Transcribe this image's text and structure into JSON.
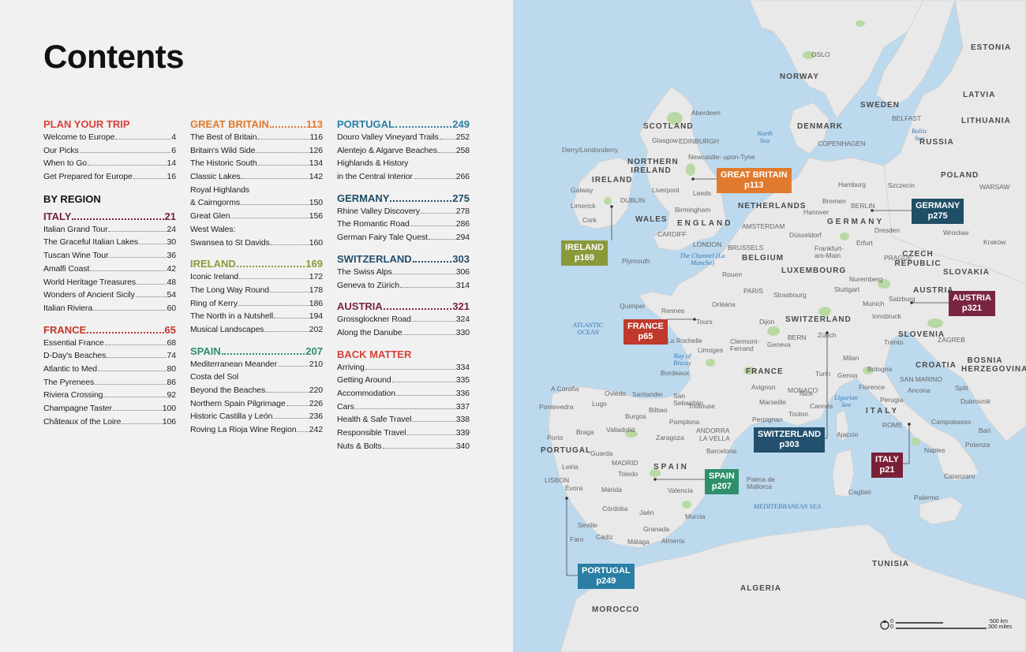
{
  "page_title": "Contents",
  "colors": {
    "plan": "#d9413a",
    "italy": "#7a2036",
    "france": "#c0392b",
    "great_britain": "#e07a2e",
    "ireland": "#8a9a3a",
    "spain": "#2f8f6b",
    "portugal": "#2a7ea4",
    "germany": "#1f4e66",
    "switzerland": "#23506e",
    "austria": "#7a2540",
    "back": "#d9413a"
  },
  "col1": {
    "plan": {
      "title": "PLAN YOUR TRIP",
      "entries": [
        {
          "name": "Welcome to Europe",
          "page": "4"
        },
        {
          "name": "Our Picks",
          "page": "6"
        },
        {
          "name": "When to Go",
          "page": "14"
        },
        {
          "name": "Get Prepared for Europe",
          "page": "16"
        }
      ]
    },
    "by_region": "BY REGION",
    "italy": {
      "title": "ITALY",
      "page": "21",
      "entries": [
        {
          "name": "Italian Grand Tour",
          "page": "24"
        },
        {
          "name": "The Graceful Italian Lakes",
          "page": "30"
        },
        {
          "name": "Tuscan Wine Tour",
          "page": "36"
        },
        {
          "name": "Amalfi Coast",
          "page": "42"
        },
        {
          "name": "World Heritage Treasures",
          "page": "48"
        },
        {
          "name": "Wonders of Ancient Sicily",
          "page": "54"
        },
        {
          "name": "Italian Riviera",
          "page": "60"
        }
      ]
    },
    "france": {
      "title": "FRANCE",
      "page": "65",
      "entries": [
        {
          "name": "Essential France",
          "page": "68"
        },
        {
          "name": "D-Day's Beaches",
          "page": "74"
        },
        {
          "name": "Atlantic to Med",
          "page": "80"
        },
        {
          "name": "The Pyrenees",
          "page": "86"
        },
        {
          "name": "Riviera Crossing",
          "page": "92"
        },
        {
          "name": "Champagne Taster",
          "page": "100"
        },
        {
          "name": "Châteaux of the Loire",
          "page": "106"
        }
      ]
    }
  },
  "col2": {
    "great_britain": {
      "title": "GREAT BRITAIN",
      "page": "113",
      "entries": [
        {
          "name": "The Best of Britain",
          "page": "116"
        },
        {
          "name": "Britain's Wild Side",
          "page": "126"
        },
        {
          "name": "The Historic South",
          "page": "134"
        },
        {
          "name": "Classic Lakes",
          "page": "142"
        },
        {
          "name": "Royal Highlands",
          "page": ""
        },
        {
          "name": "& Cairngorms",
          "page": "150"
        },
        {
          "name": "Great Glen",
          "page": "156"
        },
        {
          "name": "West Wales:",
          "page": ""
        },
        {
          "name": "Swansea to St Davids",
          "page": "160"
        }
      ]
    },
    "ireland": {
      "title": "IRELAND",
      "page": "169",
      "entries": [
        {
          "name": "Iconic Ireland",
          "page": "172"
        },
        {
          "name": "The Long Way Round",
          "page": "178"
        },
        {
          "name": "Ring of Kerry",
          "page": "186"
        },
        {
          "name": "The North in a Nutshell",
          "page": "194"
        },
        {
          "name": "Musical Landscapes",
          "page": "202"
        }
      ]
    },
    "spain": {
      "title": "SPAIN",
      "page": "207",
      "entries": [
        {
          "name": "Mediterranean Meander",
          "page": "210"
        },
        {
          "name": "Costa del Sol",
          "page": ""
        },
        {
          "name": "Beyond the Beaches",
          "page": "220"
        },
        {
          "name": "Northern Spain Pilgrimage",
          "page": "226"
        },
        {
          "name": "Historic Castilla y León",
          "page": "236"
        },
        {
          "name": "Roving La Rioja Wine Region",
          "page": "242"
        }
      ]
    }
  },
  "col3": {
    "portugal": {
      "title": "PORTUGAL",
      "page": "249",
      "entries": [
        {
          "name": "Douro Valley Vineyard Trails",
          "page": "252"
        },
        {
          "name": "Alentejo & Algarve Beaches",
          "page": "258"
        },
        {
          "name": "Highlands & History",
          "page": ""
        },
        {
          "name": "in the Central Interior",
          "page": "266"
        }
      ]
    },
    "germany": {
      "title": "GERMANY",
      "page": "275",
      "entries": [
        {
          "name": "Rhine Valley Discovery",
          "page": "278"
        },
        {
          "name": "The Romantic Road",
          "page": "286"
        },
        {
          "name": "German Fairy Tale Quest",
          "page": "294"
        }
      ]
    },
    "switzerland": {
      "title": "SWITZERLAND",
      "page": "303",
      "entries": [
        {
          "name": "The Swiss Alps",
          "page": "306"
        },
        {
          "name": "Geneva to Zürich",
          "page": "314"
        }
      ]
    },
    "austria": {
      "title": "AUSTRIA",
      "page": "321",
      "entries": [
        {
          "name": "Grossglockner Road",
          "page": "324"
        },
        {
          "name": "Along the Danube",
          "page": "330"
        }
      ]
    },
    "back": {
      "title": "BACK MATTER",
      "entries": [
        {
          "name": "Arriving",
          "page": "334"
        },
        {
          "name": "Getting Around",
          "page": "335"
        },
        {
          "name": "Accommodation",
          "page": "336"
        },
        {
          "name": "Cars",
          "page": "337"
        },
        {
          "name": "Health & Safe Travel",
          "page": "338"
        },
        {
          "name": "Responsible Travel",
          "page": "339"
        },
        {
          "name": "Nuts & Bolts",
          "page": "340"
        }
      ]
    }
  },
  "map": {
    "callouts": {
      "great_britain": {
        "name": "GREAT BRITAIN",
        "page": "p113"
      },
      "ireland": {
        "name": "IRELAND",
        "page": "p169"
      },
      "germany": {
        "name": "GERMANY",
        "page": "p275"
      },
      "france": {
        "name": "FRANCE",
        "page": "p65"
      },
      "austria": {
        "name": "AUSTRIA",
        "page": "p321"
      },
      "switzerland": {
        "name": "SWITZERLAND",
        "page": "p303"
      },
      "italy": {
        "name": "ITALY",
        "page": "p21"
      },
      "spain": {
        "name": "SPAIN",
        "page": "p207"
      },
      "portugal": {
        "name": "PORTUGAL",
        "page": "p249"
      }
    },
    "countries": {
      "norway": "NORWAY",
      "sweden": "SWEDEN",
      "estonia": "ESTONIA",
      "latvia": "LATVIA",
      "lithuania": "LITHUANIA",
      "russia": "RUSSIA",
      "denmark": "DENMARK",
      "scotland": "SCOTLAND",
      "northern_ireland": "NORTHERN IRELAND",
      "ireland": "IRELAND",
      "wales": "WALES",
      "england": "ENGLAND",
      "netherlands": "NETHERLANDS",
      "germany": "GERMANY",
      "poland": "POLAND",
      "belgium": "BELGIUM",
      "luxembourg": "LUXEMBOURG",
      "czech": "CZECH REPUBLIC",
      "slovakia": "SLOVAKIA",
      "austria": "AUSTRIA",
      "switzerland": "SWITZERLAND",
      "slovenia": "SLOVENIA",
      "croatia": "CROATIA",
      "bosnia": "BOSNIA HERZEGOVINA",
      "france": "FRANCE",
      "monaco": "MONACO",
      "san_marino": "SAN MARINO",
      "italy": "ITALY",
      "andorra": "ANDORRA",
      "spain": "SPAIN",
      "portugal": "PORTUGAL",
      "tunisia": "TUNISIA",
      "algeria": "ALGERIA",
      "morocco": "MOROCCO"
    },
    "seas": {
      "north_sea": "North Sea",
      "baltic_sea": "Baltic Sea",
      "channel": "The Channel (La Manche)",
      "atlantic": "ATLANTIC OCEAN",
      "biscay": "Bay of Biscay",
      "ligurian": "Ligurian Sea",
      "mediterranean": "MEDITERRANEAN SEA"
    },
    "cities": {
      "oslo": "OSLO",
      "copenhagen": "COPENHAGEN",
      "edinburgh": "EDINBURGH",
      "glasgow": "Glasgow",
      "aberdeen": "Aberdeen",
      "newcastle": "Newcastle- upon-Tyne",
      "derry": "Derry/Londonderry",
      "belfast": "BELFAST",
      "dublin": "DUBLIN",
      "galway": "Galway",
      "limerick": "Limerick",
      "cork": "Cork",
      "liverpool": "Liverpool",
      "leeds": "Leeds",
      "birmingham": "Birmingham",
      "cardiff": "CARDIFF",
      "london": "LONDON",
      "plymouth": "Plymouth",
      "amsterdam": "AMSTERDAM",
      "brussels": "BRUSSELS",
      "hamburg": "Hamburg",
      "bremen": "Bremen",
      "berlin": "BERLIN",
      "hanover": "Hanover",
      "dresden": "Dresden",
      "wroclaw": "Wrocław",
      "szczecin": "Szczecin",
      "warsaw": "WARSAW",
      "krakow": "Kraków",
      "prague": "PRAGUE",
      "dusseldorf": "Düsseldorf",
      "frankfurt": "Frankfurt- am-Main",
      "erfurt": "Erfurt",
      "nuremberg": "Nuremberg",
      "stuttgart": "Stuttgart",
      "munich": "Munich",
      "salzburg": "Salzburg",
      "innsbruck": "Innsbruck",
      "zagreb": "ZAGREB",
      "paris": "PARIS",
      "rouen": "Rouen",
      "strasbourg": "Strasbourg",
      "rennes": "Rennes",
      "quimper": "Quimper",
      "orleans": "Orléans",
      "tours": "Tours",
      "dijon": "Dijon",
      "la_rochelle": "La Rochelle",
      "limoges": "Limoges",
      "clermont": "Clermont- Ferrand",
      "geneva": "Geneva",
      "bern": "BERN",
      "zurich": "Zürich",
      "milan": "Milan",
      "turin": "Turin",
      "genoa": "Genoa",
      "bologna": "Bologna",
      "florence": "Florence",
      "ancona": "Ancona",
      "perugia": "Perugia",
      "trento": "Trento",
      "rome": "ROME",
      "naples": "Naples",
      "bari": "Bari",
      "campobasso": "Campobasso",
      "potenza": "Potenza",
      "catanzaro": "Catanzaro",
      "palermo": "Palermo",
      "cagliari": "Cagliari",
      "split": "Split",
      "dubrovnik": "Dubrovnik",
      "bordeaux": "Bordeaux",
      "toulouse": "Toulouse",
      "avignon": "Avignon",
      "marseille": "Marseille",
      "nice": "Nice",
      "cannes": "Cannes",
      "toulon": "Toulon",
      "perpignan": "Perpignan",
      "ajaccio": "Ajaccio",
      "acoruna": "A Coruña",
      "oviedo": "Oviedo",
      "santander": "Santander",
      "bilbao": "Bilbao",
      "sansebastian": "San Sebastián",
      "pamplona": "Pamplona",
      "pontevedra": "Pontevedra",
      "lugo": "Lugo",
      "braga": "Braga",
      "porto": "Porto",
      "burgos": "Burgos",
      "valladolid": "Valladolid",
      "zaragoza": "Zaragoza",
      "barcelona": "Barcelona",
      "lavella": "LA VELLA",
      "guarda": "Guarda",
      "madrid": "MADRID",
      "toledo": "Toledo",
      "leiria": "Leiria",
      "lisbon": "LISBON",
      "evora": "Évora",
      "merida": "Mérida",
      "valencia": "Valencia",
      "palma": "Palma de Mallorca",
      "cordoba": "Córdoba",
      "seville": "Seville",
      "granada": "Granada",
      "jaen": "Jaén",
      "murcia": "Murcia",
      "malaga": "Málaga",
      "almeria": "Almería",
      "cadiz": "Cádiz",
      "faro": "Faro"
    },
    "scale": {
      "km": "500 km",
      "miles": "300 miles",
      "zero_km": "0",
      "zero_mi": "0"
    }
  }
}
